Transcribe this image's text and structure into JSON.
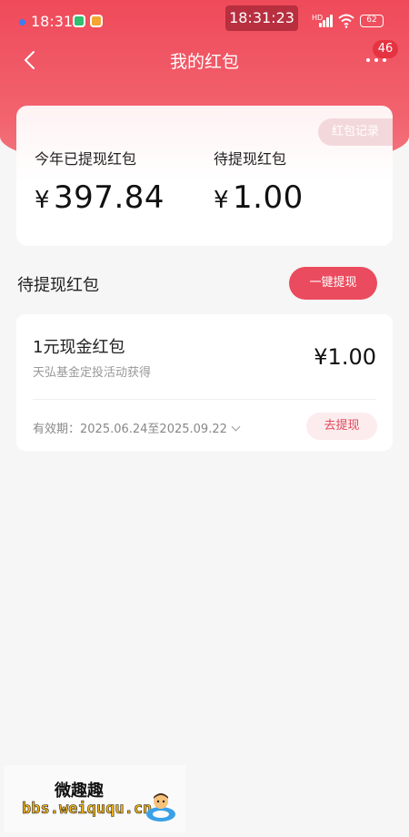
{
  "status_bar": {
    "time_left": "18:31",
    "time_center": "18:31:23",
    "hd_label": "HD",
    "battery": "62"
  },
  "nav": {
    "title": "我的红包",
    "badge_count": "46"
  },
  "summary": {
    "records_button": "红包记录",
    "withdrawn_label": "今年已提现红包",
    "withdrawn_currency": "¥",
    "withdrawn_amount": "397.84",
    "pending_label": "待提现红包",
    "pending_currency": "¥",
    "pending_amount": "1.00"
  },
  "section": {
    "title": "待提现红包",
    "withdraw_all_button": "一键提现"
  },
  "coupon": {
    "name": "1元现金红包",
    "source": "天弘基金定投活动获得",
    "amount": "¥1.00",
    "validity": "有效期：2025.06.24至2025.09.22",
    "action_button": "去提现"
  },
  "watermark": {
    "title": "微趣趣",
    "url": "bbs.weiququ.cn"
  },
  "colors": {
    "brand_red": "#ef4a5a",
    "button_red": "#ea4b5e",
    "light_pink": "#fdecee"
  }
}
